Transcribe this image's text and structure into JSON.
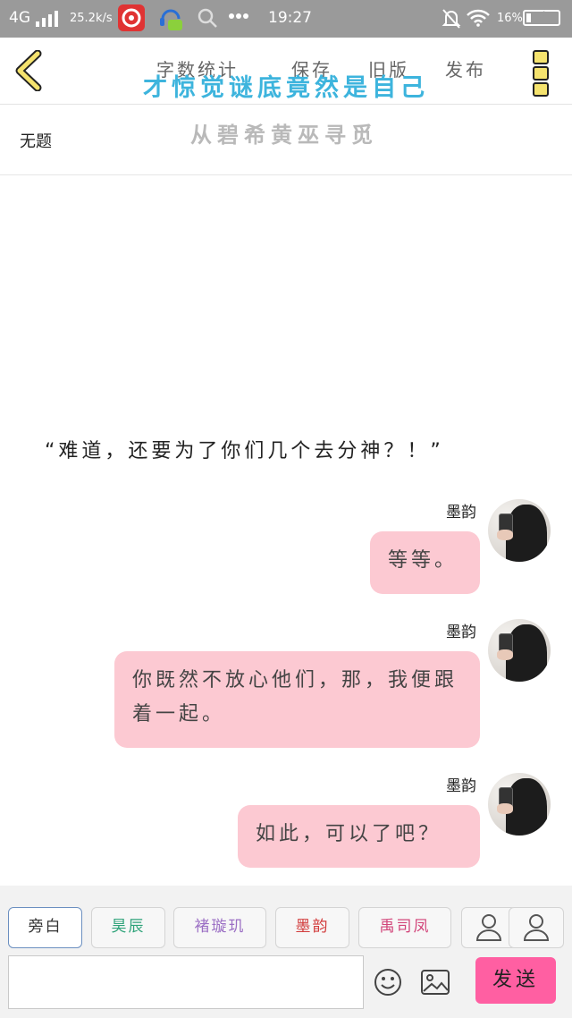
{
  "status_bar": {
    "network": "4G",
    "speed": "25.2k/s",
    "time": "19:27",
    "battery": "16%",
    "battery_level": 0.16,
    "icons": [
      "signal-icon",
      "netease-music-icon",
      "assistant-icon",
      "search-icon",
      "more-icon",
      "mute-icon",
      "wifi-icon",
      "battery-icon"
    ]
  },
  "toolbar": {
    "word_count": "字数统计",
    "save": "保存",
    "old_version": "旧版",
    "publish": "发布",
    "overlay_title": "才惊觉谜底竟然是自己"
  },
  "document": {
    "title": "无题",
    "subtitle": "从碧希黄巫寻觅"
  },
  "story": {
    "narration": "“难道，还要为了你们几个去分神？！”",
    "messages": [
      {
        "speaker": "墨韵",
        "text": "等等。"
      },
      {
        "speaker": "墨韵",
        "text": "你既然不放心他们，那，我便跟着一起。"
      },
      {
        "speaker": "墨韵",
        "text": "如此，可以了吧？"
      }
    ]
  },
  "roles": [
    {
      "label": "旁白",
      "color": "#333333"
    },
    {
      "label": "昊辰",
      "color": "#2fa37a"
    },
    {
      "label": "褚璇玑",
      "color": "#9b6fc4"
    },
    {
      "label": "墨韵",
      "color": "#d23c3c"
    },
    {
      "label": "禹司凤",
      "color": "#d2457a"
    }
  ],
  "composer": {
    "input_value": "",
    "send_label": "发送"
  },
  "colors": {
    "bubble": "#fcc9d2",
    "send_button": "#ff5fa2",
    "overlay_title": "#3db4dd",
    "status_bar": "#9a9a9a"
  }
}
